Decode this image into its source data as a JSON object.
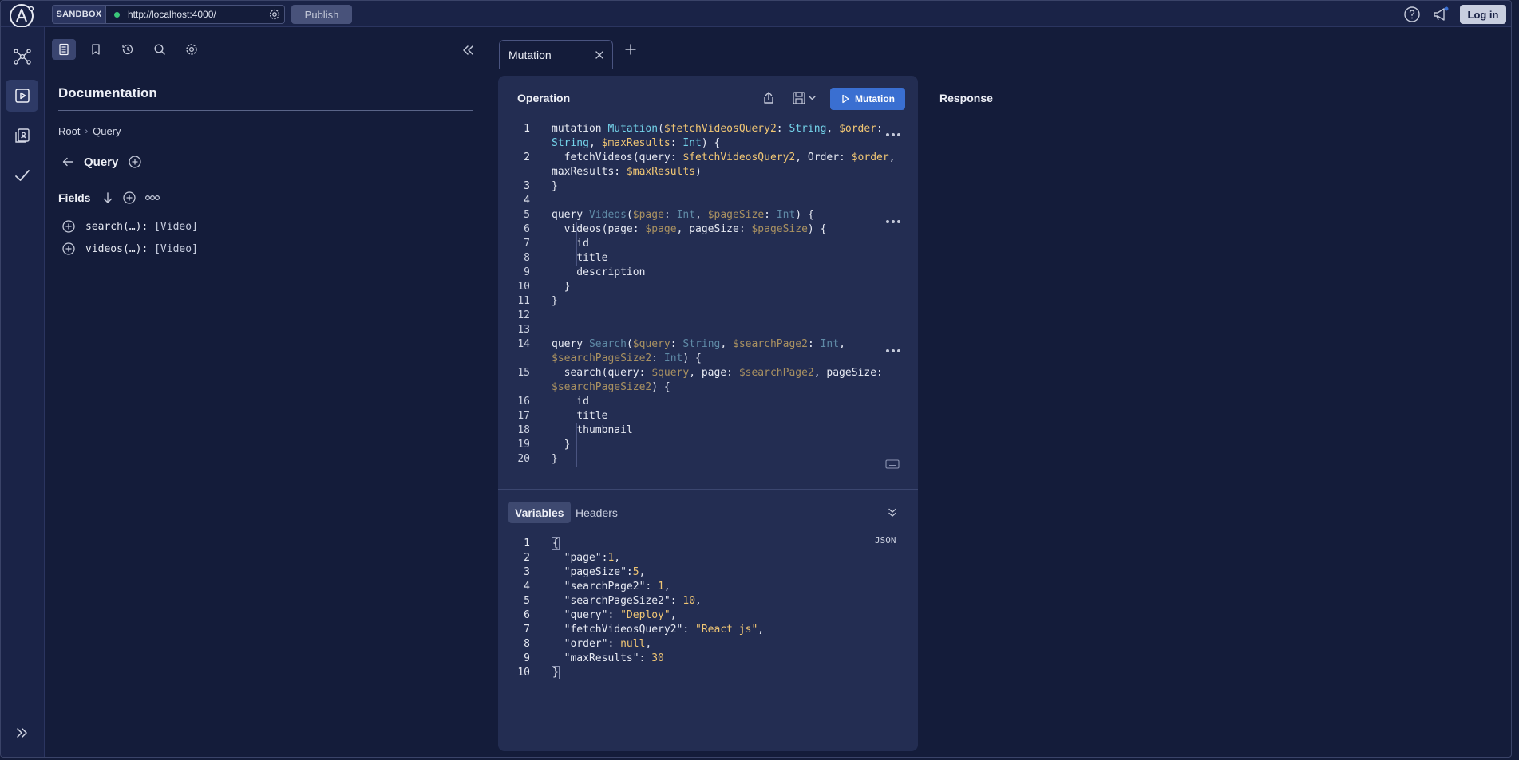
{
  "topbar": {
    "sandbox_label": "SANDBOX",
    "url": "http://localhost:4000/",
    "publish_label": "Publish",
    "login_label": "Log in"
  },
  "rail": {
    "items": [
      "schema-icon",
      "explorer-icon",
      "operations-collection-icon",
      "checks-icon"
    ],
    "expand_icon": "expand-double-chevron-icon"
  },
  "doc": {
    "title": "Documentation",
    "breadcrumb": [
      "Root",
      "Query"
    ],
    "type_title": "Query",
    "fields_label": "Fields",
    "fields": [
      {
        "name": "search(…):",
        "type": "[Video]"
      },
      {
        "name": "videos(…):",
        "type": "[Video]"
      }
    ]
  },
  "tab": {
    "label": "Mutation"
  },
  "operation": {
    "title": "Operation",
    "run_label": "Mutation",
    "lines": [
      {
        "n": "1",
        "parts": [
          [
            "kw",
            "mutation "
          ],
          [
            "fn",
            "Mutation"
          ],
          [
            "kw",
            "("
          ],
          [
            "var",
            "$fetchVideosQuery2"
          ],
          [
            "kw",
            ": "
          ],
          [
            "typ",
            "String"
          ],
          [
            "kw",
            ", "
          ],
          [
            "var",
            "$order"
          ],
          [
            "kw",
            ":"
          ]
        ]
      },
      {
        "n": "",
        "parts": [
          [
            "typ",
            "String"
          ],
          [
            "kw",
            ", "
          ],
          [
            "var",
            "$maxResults"
          ],
          [
            "kw",
            ": "
          ],
          [
            "typ",
            "Int"
          ],
          [
            "kw",
            ") {"
          ]
        ]
      },
      {
        "n": "2",
        "parts": [
          [
            "kw",
            "  fetchVideos(query: "
          ],
          [
            "var",
            "$fetchVideosQuery2"
          ],
          [
            "kw",
            ", Order: "
          ],
          [
            "var",
            "$order"
          ],
          [
            "kw",
            ","
          ]
        ]
      },
      {
        "n": "",
        "parts": [
          [
            "kw",
            "maxResults: "
          ],
          [
            "var",
            "$maxResults"
          ],
          [
            "kw",
            ")"
          ]
        ]
      },
      {
        "n": "3",
        "parts": [
          [
            "kw",
            "}"
          ]
        ]
      },
      {
        "n": "4",
        "parts": []
      },
      {
        "n": "5",
        "parts": [
          [
            "kw",
            "query "
          ],
          [
            "fn",
            "Videos"
          ],
          [
            "kw",
            "("
          ],
          [
            "var",
            "$page"
          ],
          [
            "kw",
            ": "
          ],
          [
            "typ",
            "Int"
          ],
          [
            "kw",
            ", "
          ],
          [
            "var",
            "$pageSize"
          ],
          [
            "kw",
            ": "
          ],
          [
            "typ",
            "Int"
          ],
          [
            "kw",
            ") {"
          ]
        ]
      },
      {
        "n": "6",
        "parts": [
          [
            "kw",
            "  videos(page: "
          ],
          [
            "var",
            "$page"
          ],
          [
            "kw",
            ", pageSize: "
          ],
          [
            "var",
            "$pageSize"
          ],
          [
            "kw",
            ") {"
          ]
        ]
      },
      {
        "n": "7",
        "parts": [
          [
            "kw",
            "    id"
          ]
        ]
      },
      {
        "n": "8",
        "parts": [
          [
            "kw",
            "    title"
          ]
        ]
      },
      {
        "n": "9",
        "parts": [
          [
            "kw",
            "    description"
          ]
        ]
      },
      {
        "n": "10",
        "parts": [
          [
            "kw",
            "  }"
          ]
        ]
      },
      {
        "n": "11",
        "parts": [
          [
            "kw",
            "}"
          ]
        ]
      },
      {
        "n": "12",
        "parts": []
      },
      {
        "n": "13",
        "parts": []
      },
      {
        "n": "14",
        "parts": [
          [
            "kw",
            "query "
          ],
          [
            "fn",
            "Search"
          ],
          [
            "kw",
            "("
          ],
          [
            "var",
            "$query"
          ],
          [
            "kw",
            ": "
          ],
          [
            "typ",
            "String"
          ],
          [
            "kw",
            ", "
          ],
          [
            "var",
            "$searchPage2"
          ],
          [
            "kw",
            ": "
          ],
          [
            "typ",
            "Int"
          ],
          [
            "kw",
            ","
          ]
        ]
      },
      {
        "n": "",
        "parts": [
          [
            "var",
            "$searchPageSize2"
          ],
          [
            "kw",
            ": "
          ],
          [
            "typ",
            "Int"
          ],
          [
            "kw",
            ") {"
          ]
        ]
      },
      {
        "n": "15",
        "parts": [
          [
            "kw",
            "  search(query: "
          ],
          [
            "var",
            "$query"
          ],
          [
            "kw",
            ", page: "
          ],
          [
            "var",
            "$searchPage2"
          ],
          [
            "kw",
            ", pageSize:"
          ]
        ]
      },
      {
        "n": "",
        "parts": [
          [
            "var",
            "$searchPageSize2"
          ],
          [
            "kw",
            ") {"
          ]
        ]
      },
      {
        "n": "16",
        "parts": [
          [
            "kw",
            "    id"
          ]
        ]
      },
      {
        "n": "17",
        "parts": [
          [
            "kw",
            "    title"
          ]
        ]
      },
      {
        "n": "18",
        "parts": [
          [
            "kw",
            "    thumbnail"
          ]
        ]
      },
      {
        "n": "19",
        "parts": [
          [
            "kw",
            "  }"
          ]
        ]
      },
      {
        "n": "20",
        "parts": [
          [
            "kw",
            "}"
          ]
        ]
      }
    ]
  },
  "variables": {
    "tabs": [
      "Variables",
      "Headers"
    ],
    "format_label": "JSON",
    "lines": [
      {
        "n": "1",
        "parts": [
          [
            "kw",
            "{"
          ]
        ]
      },
      {
        "n": "2",
        "parts": [
          [
            "vkey",
            "  \"page\":"
          ],
          [
            "vnum",
            "1"
          ],
          [
            "vkey",
            ","
          ]
        ]
      },
      {
        "n": "3",
        "parts": [
          [
            "vkey",
            "  \"pageSize\":"
          ],
          [
            "vnum",
            "5"
          ],
          [
            "vkey",
            ","
          ]
        ]
      },
      {
        "n": "4",
        "parts": [
          [
            "vkey",
            "  \"searchPage2\": "
          ],
          [
            "vnum",
            "1"
          ],
          [
            "vkey",
            ","
          ]
        ]
      },
      {
        "n": "5",
        "parts": [
          [
            "vkey",
            "  \"searchPageSize2\": "
          ],
          [
            "vnum",
            "10"
          ],
          [
            "vkey",
            ","
          ]
        ]
      },
      {
        "n": "6",
        "parts": [
          [
            "vkey",
            "  \"query\": "
          ],
          [
            "vstr",
            "\"Deploy\""
          ],
          [
            "vkey",
            ","
          ]
        ]
      },
      {
        "n": "7",
        "parts": [
          [
            "vkey",
            "  \"fetchVideosQuery2\": "
          ],
          [
            "vstr",
            "\"React js\""
          ],
          [
            "vkey",
            ","
          ]
        ]
      },
      {
        "n": "8",
        "parts": [
          [
            "vkey",
            "  \"order\": "
          ],
          [
            "vnum",
            "null"
          ],
          [
            "vkey",
            ","
          ]
        ]
      },
      {
        "n": "9",
        "parts": [
          [
            "vkey",
            "  \"maxResults\": "
          ],
          [
            "vnum",
            "30"
          ]
        ]
      },
      {
        "n": "10",
        "parts": [
          [
            "kw",
            "}"
          ]
        ]
      }
    ]
  },
  "response": {
    "title": "Response"
  },
  "colors": {
    "background": "#141c3a",
    "panel": "#232d52",
    "accent": "#3a6fd1",
    "variable": "#f0c674",
    "type": "#73d2e8",
    "status_ok": "#3bc77a"
  }
}
